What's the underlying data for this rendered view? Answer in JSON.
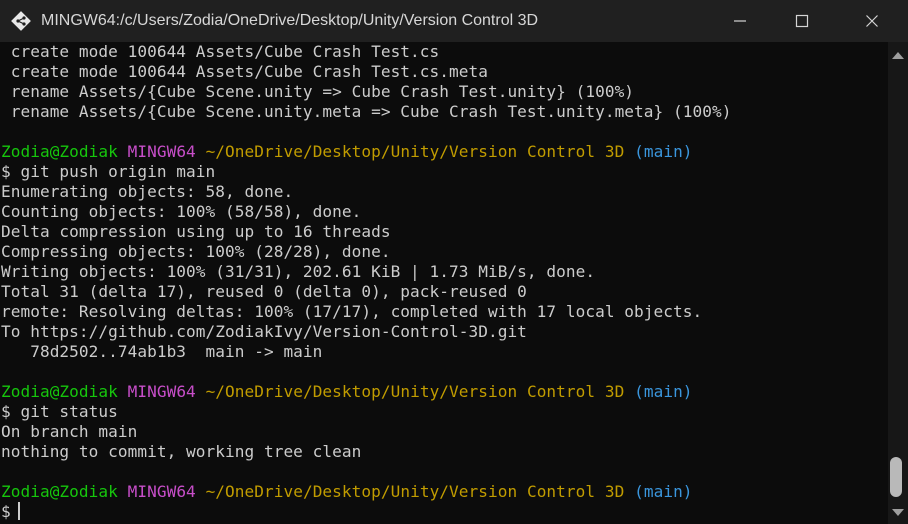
{
  "window": {
    "title": "MINGW64:/c/Users/Zodia/OneDrive/Desktop/Unity/Version Control 3D",
    "icon": "git-bash-icon",
    "buttons": [
      "minimize-icon",
      "maximize-icon",
      "close-icon"
    ]
  },
  "colors": {
    "background": "#0c0c0c",
    "text": "#cccccc",
    "user": "#16c60c",
    "shell": "#c74ec9",
    "path": "#c19c00",
    "branch": "#3a96dd"
  },
  "prompt": {
    "user": "Zodia@Zodiak",
    "shell": "MINGW64",
    "path": "~/OneDrive/Desktop/Unity/Version Control 3D",
    "branch": "(main)"
  },
  "terminal": {
    "lines": [
      " create mode 100644 Assets/Cube Crash Test.cs",
      " create mode 100644 Assets/Cube Crash Test.cs.meta",
      " rename Assets/{Cube Scene.unity => Cube Crash Test.unity} (100%)",
      " rename Assets/{Cube Scene.unity.meta => Cube Crash Test.unity.meta} (100%)",
      "",
      "__PROMPT__",
      "$ git push origin main",
      "Enumerating objects: 58, done.",
      "Counting objects: 100% (58/58), done.",
      "Delta compression using up to 16 threads",
      "Compressing objects: 100% (28/28), done.",
      "Writing objects: 100% (31/31), 202.61 KiB | 1.73 MiB/s, done.",
      "Total 31 (delta 17), reused 0 (delta 0), pack-reused 0",
      "remote: Resolving deltas: 100% (17/17), completed with 17 local objects.",
      "To https://github.com/ZodiakIvy/Version-Control-3D.git",
      "   78d2502..74ab1b3  main -> main",
      "",
      "__PROMPT__",
      "$ git status",
      "On branch main",
      "nothing to commit, working tree clean",
      "",
      "__PROMPT__",
      "$"
    ]
  }
}
